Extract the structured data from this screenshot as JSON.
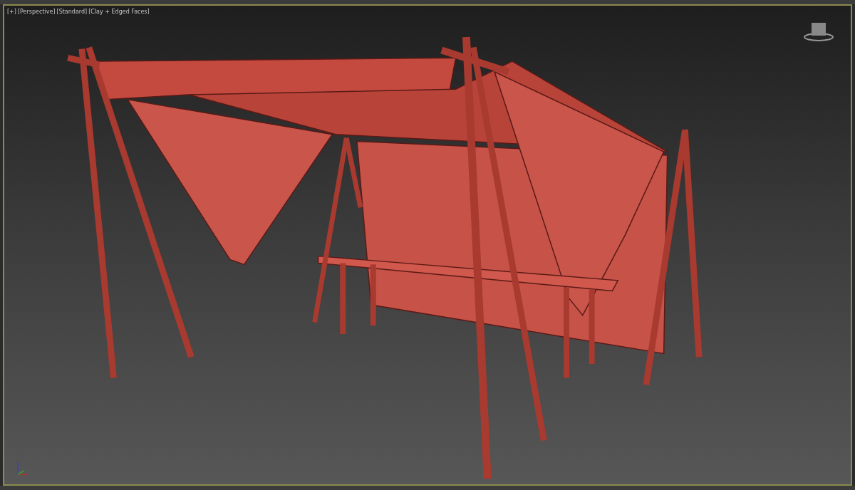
{
  "viewport": {
    "labels": [
      {
        "text": "[+]"
      },
      {
        "text": "[Perspective]"
      },
      {
        "text": "[Standard]"
      },
      {
        "text": "[Clay + Edged Faces]"
      }
    ]
  }
}
